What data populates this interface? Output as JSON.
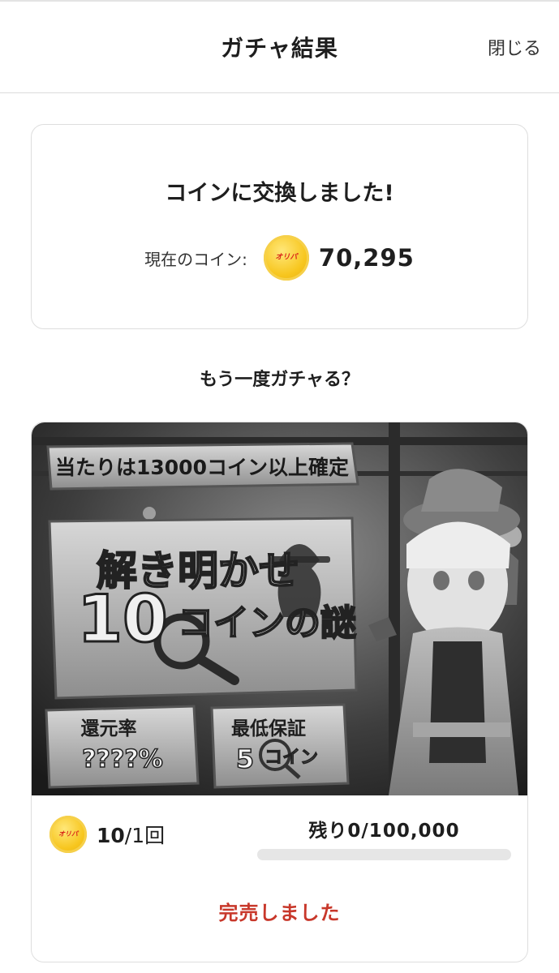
{
  "header": {
    "title": "ガチャ結果",
    "close_label": "閉じる"
  },
  "result": {
    "message": "コインに交換しました!",
    "coin_label": "現在のコイン:",
    "coin_value": "70,295",
    "coin_icon": "gold-coin-icon"
  },
  "again_prompt": "もう一度ガチャる？",
  "gacha": {
    "banner": {
      "top_plate": "当たりは13000コイン以上確定",
      "title_line1": "解き明かせ",
      "title_number": "10",
      "title_line2": "コインの謎",
      "rate_label": "還元率",
      "rate_value": "????%",
      "guarantee_label": "最低保証",
      "guarantee_number": "5",
      "guarantee_unit": "コイン"
    },
    "price_value": "10",
    "price_unit": "/1回",
    "remaining": "残り0/100,000",
    "remaining_fraction": 0,
    "status": "完売しました"
  },
  "colors": {
    "accent_red": "#c8382b",
    "coin_gold": "#f7c61e"
  }
}
